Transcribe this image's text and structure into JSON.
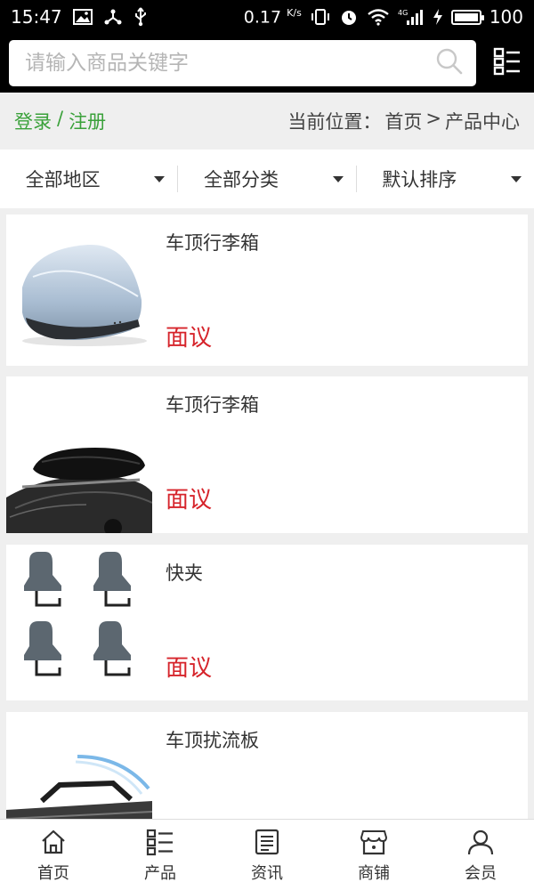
{
  "status_bar": {
    "time": "15:47",
    "net_speed": "0.17",
    "net_unit": "K/s",
    "battery": "100",
    "signal_label": "4G",
    "icons": [
      "image-icon",
      "share-icon",
      "usb-icon",
      "vibrate-icon",
      "alarm-icon",
      "wifi-icon",
      "signal-icon",
      "charging-icon",
      "battery-icon"
    ]
  },
  "search": {
    "placeholder": "请输入商品关键字",
    "value": ""
  },
  "crumbs": {
    "login": "登录",
    "separator": "/",
    "register": "注册",
    "location_prefix": "当前位置：",
    "home": "首页",
    "arrow": ">",
    "current": "产品中心"
  },
  "filters": [
    {
      "label": "全部地区"
    },
    {
      "label": "全部分类"
    },
    {
      "label": "默认排序"
    }
  ],
  "products": [
    {
      "name": "车顶行李箱",
      "price": "面议",
      "image": "roof-box-silver"
    },
    {
      "name": "车顶行李箱",
      "price": "面议",
      "image": "roof-box-black-on-car"
    },
    {
      "name": "快夹",
      "price": "面议",
      "image": "quick-clamps"
    },
    {
      "name": "车顶扰流板",
      "price": "面议",
      "image": "roof-spoiler"
    }
  ],
  "nav": [
    {
      "label": "首页",
      "icon": "home-icon"
    },
    {
      "label": "产品",
      "icon": "list-icon"
    },
    {
      "label": "资讯",
      "icon": "news-icon"
    },
    {
      "label": "商铺",
      "icon": "store-icon"
    },
    {
      "label": "会员",
      "icon": "user-icon"
    }
  ]
}
